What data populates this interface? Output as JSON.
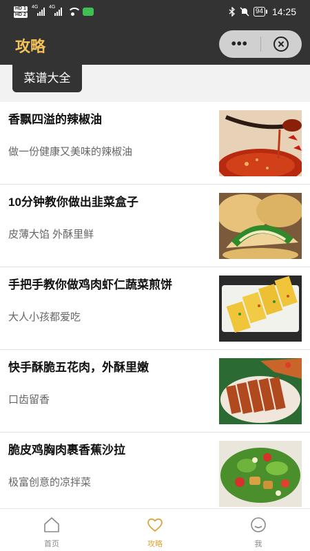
{
  "status_bar": {
    "hd1": "HD 1",
    "hd2": "HD 2",
    "net1": "4G",
    "net2": "4G",
    "battery": "94",
    "time": "14:25"
  },
  "header": {
    "title": "攻略",
    "more_label": "•••"
  },
  "category_tab": {
    "label": "菜谱大全"
  },
  "recipes": [
    {
      "title": "香飘四溢的辣椒油",
      "subtitle": "做一份健康又美味的辣椒油",
      "image": "chili-oil-photo"
    },
    {
      "title": "10分钟教你做出韭菜盒子",
      "subtitle": "皮薄大馅 外酥里鲜",
      "image": "chive-box-photo"
    },
    {
      "title": "手把手教你做鸡肉虾仁蔬菜煎饼",
      "subtitle": "大人小孩都爱吃",
      "image": "veggie-pancake-photo"
    },
    {
      "title": "快手酥脆五花肉，外酥里嫩",
      "subtitle": "口齿留香",
      "image": "crispy-pork-photo"
    },
    {
      "title": "脆皮鸡胸肉裹香蕉沙拉",
      "subtitle": "极富创意的凉拌菜",
      "image": "chicken-salad-photo"
    }
  ],
  "bottom_nav": [
    {
      "label": "首页",
      "icon": "home-icon",
      "active": false
    },
    {
      "label": "攻略",
      "icon": "heart-icon",
      "active": true
    },
    {
      "label": "我",
      "icon": "smile-icon",
      "active": false
    }
  ],
  "colors": {
    "header_bg": "#333333",
    "accent": "#f2c15a",
    "nav_active": "#d9a53a"
  }
}
